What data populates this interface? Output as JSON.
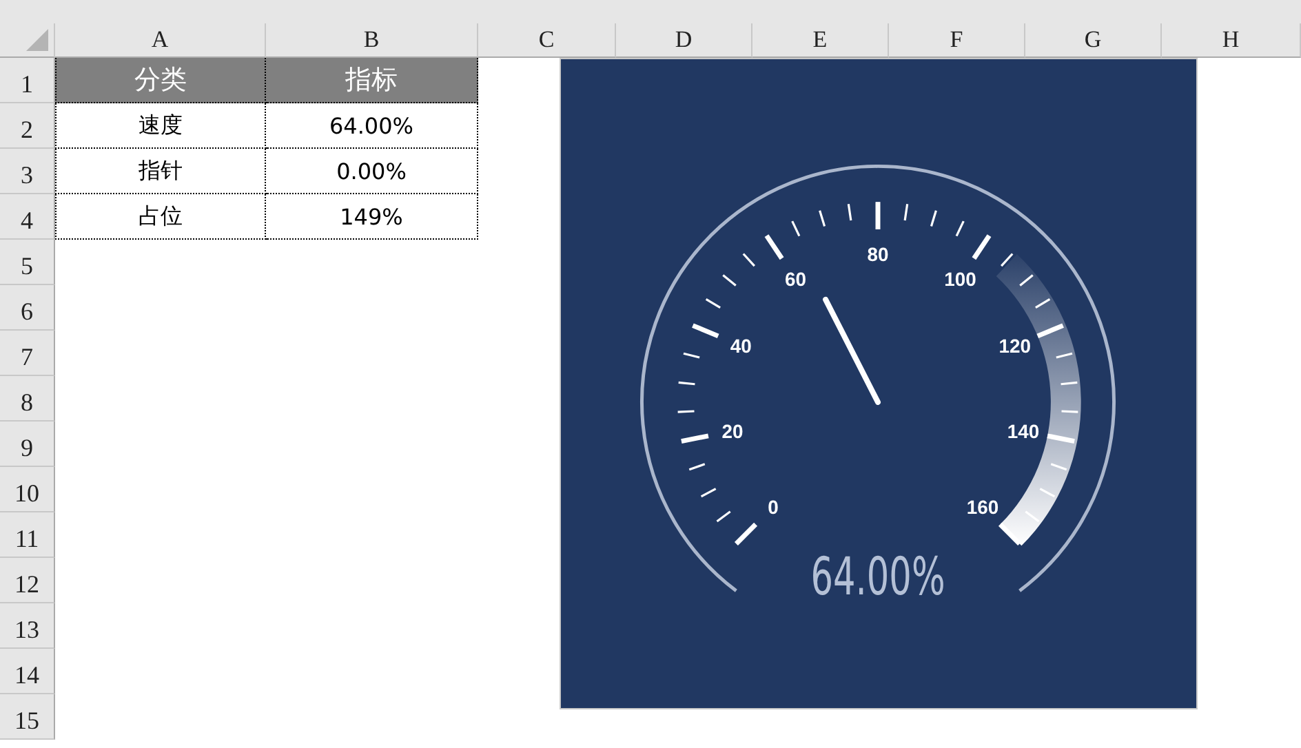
{
  "sheet": {
    "columns": [
      "A",
      "B",
      "C",
      "D",
      "E",
      "F",
      "G",
      "H"
    ],
    "rows": [
      "1",
      "2",
      "3",
      "4",
      "5",
      "6",
      "7",
      "8",
      "9",
      "10",
      "11",
      "12",
      "13",
      "14",
      "15"
    ],
    "table": {
      "header": [
        "分类",
        "指标"
      ],
      "rows": [
        [
          "速度",
          "64.00%"
        ],
        [
          "指针",
          "0.00%"
        ],
        [
          "占位",
          "149%"
        ]
      ]
    }
  },
  "chart": {
    "kind": "gauge",
    "scale_labels": [
      "0",
      "20",
      "40",
      "60",
      "80",
      "100",
      "120",
      "140",
      "160"
    ],
    "level": 0.4,
    "reading": "64.00%"
  }
}
